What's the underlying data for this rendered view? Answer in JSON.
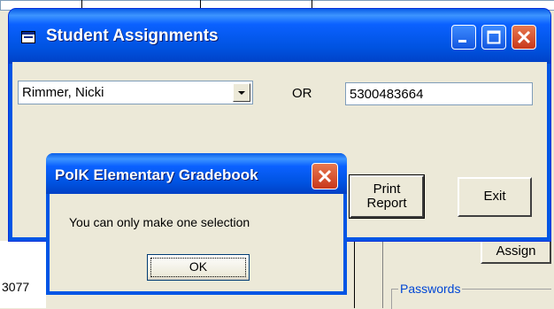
{
  "main_window": {
    "title": "Student Assignments",
    "student_combo_value": "Rimmer, Nicki",
    "or_label": "OR",
    "phone_value": "5300483664",
    "print_report_line1": "Print",
    "print_report_line2": "Report",
    "exit_label": "Exit"
  },
  "dialog": {
    "title": "PolK Elementary Gradebook",
    "message": "You can only make one selection",
    "ok_label": "OK"
  },
  "background": {
    "assign_button_label": "Assign",
    "passwords_group_label": "Passwords",
    "partial_number": "3077"
  },
  "icons": {
    "window_icon": "form-window-icon",
    "minimize": "minimize-icon",
    "maximize": "maximize-icon",
    "close": "close-icon",
    "dropdown": "chevron-down-icon",
    "dialog_close": "close-icon"
  },
  "colors": {
    "titlebar_blue": "#0054e3",
    "close_red": "#d7471f",
    "face": "#ece9d8",
    "group_label_blue": "#0046d5"
  }
}
